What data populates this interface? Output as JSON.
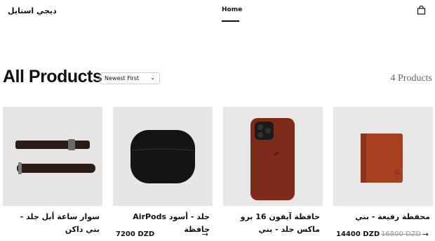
{
  "header": {
    "logo": "ديجي استايل",
    "nav_home": "Home"
  },
  "page": {
    "title": "All Products",
    "sort_value": "Newest First",
    "product_count": "4 Products"
  },
  "products": [
    {
      "name": "سوار ساعة أبل جلد - بني داكن",
      "price": "",
      "old_price": "",
      "arrow": ""
    },
    {
      "name": "جلد - أسود AirPods حافظة",
      "price": "7200 DZD",
      "old_price": "",
      "arrow": "→"
    },
    {
      "name": "حافظة آيفون 16 برو ماكس جلد - بني",
      "price": "",
      "old_price": "",
      "arrow": ""
    },
    {
      "name": "محفظة رفيعة - بني",
      "price": "14400 DZD",
      "old_price": "16800 DZD",
      "arrow": "→"
    }
  ]
}
